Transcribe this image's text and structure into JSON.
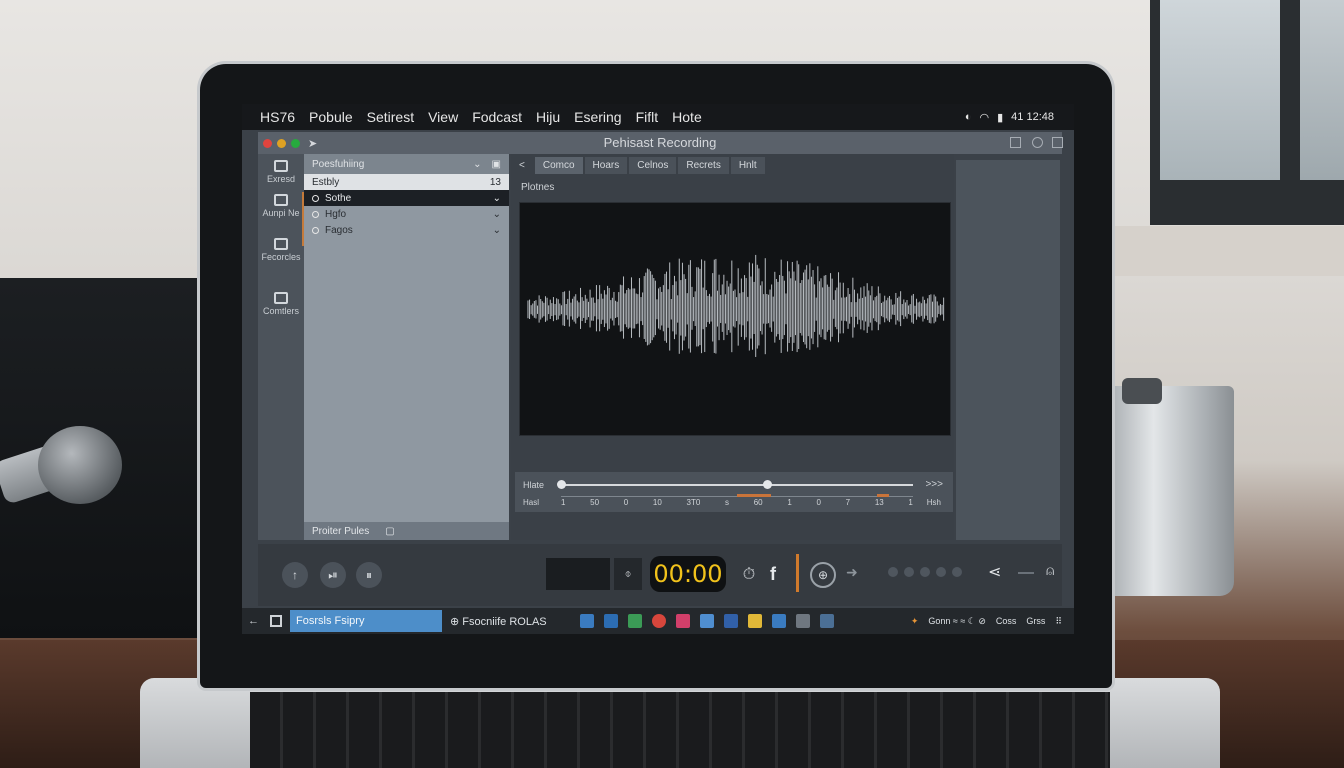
{
  "menubar": {
    "items": [
      "HS76",
      "Pobule",
      "Setirest",
      "View",
      "Fodcast",
      "Hiju",
      "Esering",
      "Fiflt",
      "Hote"
    ],
    "tray_text": "41 12:48"
  },
  "window": {
    "title": "Pehisast Recording"
  },
  "leftnav": {
    "items": [
      {
        "label": "Exresd"
      },
      {
        "label": "Aunpi Ne"
      },
      {
        "label": "Fecorcles"
      },
      {
        "label": "Comtlers"
      }
    ]
  },
  "browser": {
    "header": "Poesfuhiing",
    "rows": [
      {
        "label": "Estbly",
        "tail": "13"
      },
      {
        "label": "Sothe",
        "tail": "⌄"
      },
      {
        "label": "Hgfo",
        "tail": "⌄"
      },
      {
        "label": "Fagos",
        "tail": "⌄"
      }
    ],
    "footer": "Proiter Pules"
  },
  "editor": {
    "back": "<",
    "tabs": [
      "Comco",
      "Hoars",
      "Celnos",
      "Recrets",
      "Hnlt"
    ],
    "track_label": "Plotnes",
    "strip_label": "Hlate",
    "strip_end": ">>>",
    "ruler_left": "Hasl",
    "ruler_right": "Hsh",
    "ruler_ticks": [
      "1",
      "50",
      "0",
      "10",
      "3T0",
      "s",
      "60",
      "1",
      "0",
      "7",
      "13",
      "1"
    ]
  },
  "controls": {
    "back_icon": "up-arrow-icon",
    "timer": "00:00",
    "small_box": "⌽",
    "f_label": "f"
  },
  "taskbar": {
    "search_text": "Fosrsls Fsipry",
    "app_label": "Fsocniife ROLAS",
    "tray_text": "Gonn ≈ ≈ ☾ ⊘",
    "clock_a": "Coss",
    "clock_b": "Grss"
  },
  "colors": {
    "accent_orange": "#c9743a",
    "timer_yellow": "#f1c21b",
    "taskbar_search_blue": "#4d8ec9"
  }
}
